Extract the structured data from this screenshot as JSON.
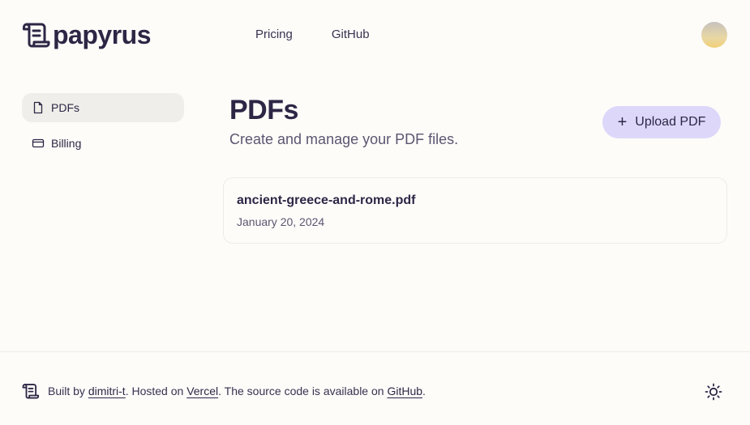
{
  "brand": {
    "name": "papyrus",
    "icon": "scroll-icon"
  },
  "nav": {
    "pricing": "Pricing",
    "github": "GitHub"
  },
  "user": {
    "avatar": "avatar"
  },
  "sidebar": {
    "items": [
      {
        "label": "PDFs",
        "icon": "file-icon",
        "active": true
      },
      {
        "label": "Billing",
        "icon": "credit-card-icon",
        "active": false
      }
    ]
  },
  "main": {
    "title": "PDFs",
    "subtitle": "Create and manage your PDF files.",
    "upload_label": "Upload PDF",
    "files": [
      {
        "name": "ancient-greece-and-rome.pdf",
        "date": "January 20, 2024"
      }
    ]
  },
  "footer": {
    "built_by": "Built by",
    "author": "dimitri-t",
    "hosted_on": ". Hosted on",
    "host": "Vercel",
    "source_text": ". The source code is available on",
    "source": "GitHub",
    "end": "."
  },
  "colors": {
    "accent": "#ddd8fa",
    "text": "#2e2645",
    "background": "#fdfcf9"
  }
}
